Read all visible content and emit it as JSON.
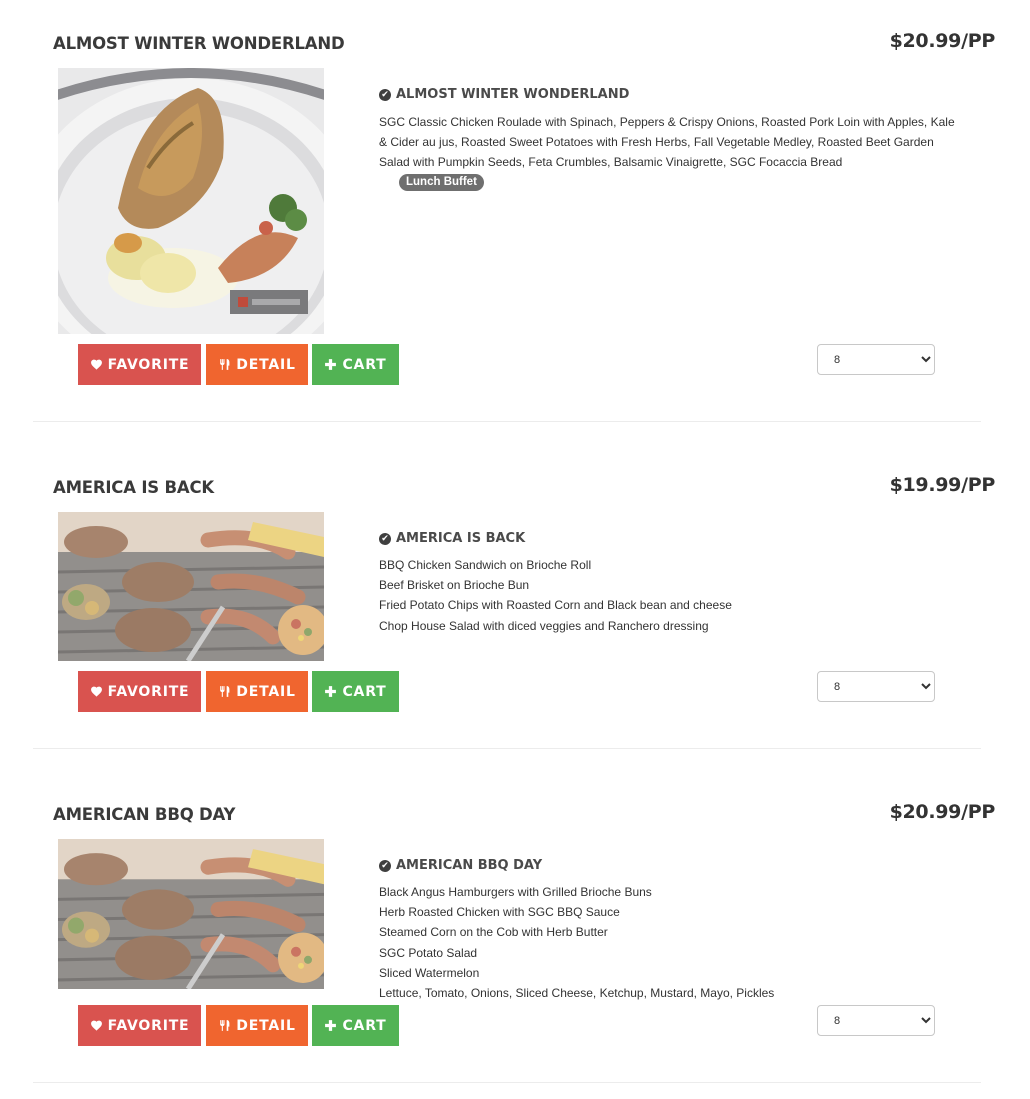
{
  "items": [
    {
      "title": "ALMOST WINTER WONDERLAND",
      "price": "$20.99/PP",
      "image_icon": "chicken-roulade-plate-photo",
      "detail_title": "ALMOST WINTER WONDERLAND",
      "description": " SGC Classic Chicken Roulade with Spinach, Peppers & Crispy Onions, Roasted Pork Loin with Apples, Kale & Cider au jus, Roasted Sweet Potatoes with Fresh Herbs, Fall Vegetable Medley, Roasted Beet Garden Salad with Pumpkin Seeds, Feta Crumbles, Balsamic Vinaigrette, SGC Focaccia Bread",
      "badge": "Lunch Buffet",
      "favorite_label": "FAVORITE",
      "detail_label": "DETAIL",
      "cart_label": "CART",
      "quantity": "8"
    },
    {
      "title": "AMERICA IS BACK",
      "price": "$19.99/PP",
      "image_icon": "bbq-grill-photo",
      "detail_title": "AMERICA IS BACK",
      "lines": [
        " BBQ Chicken Sandwich on Brioche Roll",
        "Beef Brisket on Brioche Bun",
        "Fried Potato Chips with Roasted Corn and Black bean and cheese",
        "Chop House Salad with diced veggies and Ranchero dressing"
      ],
      "favorite_label": "FAVORITE",
      "detail_label": "DETAIL",
      "cart_label": "CART",
      "quantity": "8"
    },
    {
      "title": "AMERICAN BBQ DAY",
      "price": "$20.99/PP",
      "image_icon": "bbq-grill-photo",
      "detail_title": "AMERICAN BBQ DAY",
      "lines": [
        " Black Angus Hamburgers with Grilled Brioche Buns",
        "Herb Roasted Chicken with SGC BBQ Sauce",
        "Steamed Corn on the Cob with Herb Butter",
        "SGC Potato Salad",
        "Sliced Watermelon",
        "Lettuce, Tomato, Onions, Sliced Cheese, Ketchup, Mustard, Mayo, Pickles"
      ],
      "favorite_label": "FAVORITE",
      "detail_label": "DETAIL",
      "cart_label": "CART",
      "quantity": "8"
    }
  ],
  "colors": {
    "favorite": "#d9534f",
    "detail": "#f0652f",
    "cart": "#52b354",
    "badge": "#6f6f6f"
  }
}
